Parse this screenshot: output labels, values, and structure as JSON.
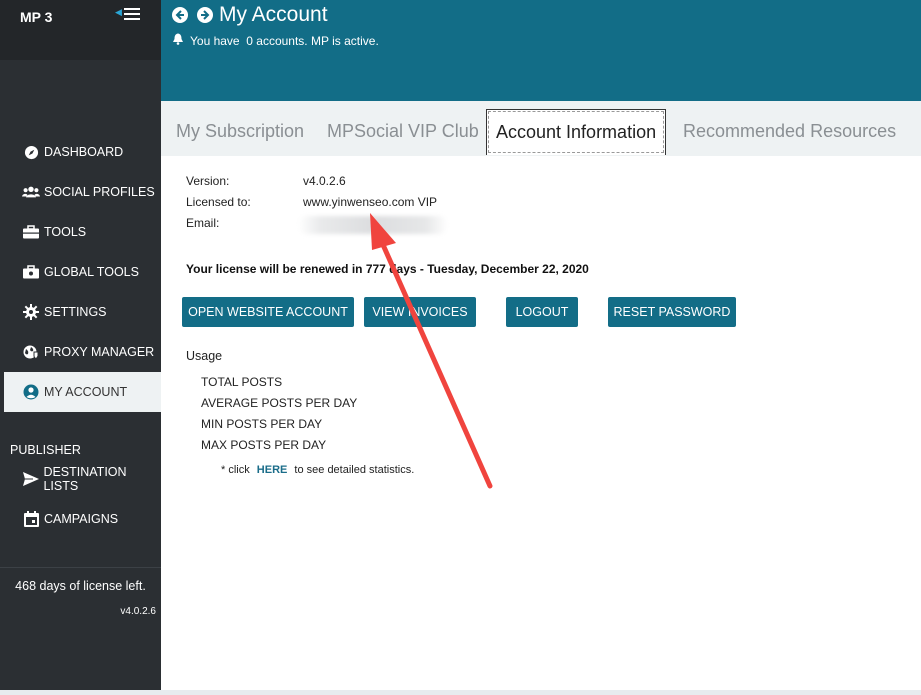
{
  "sidebar": {
    "brand": "MP 3",
    "items": [
      {
        "label": "DASHBOARD",
        "icon": "compass-icon"
      },
      {
        "label": "SOCIAL PROFILES",
        "icon": "users-icon"
      },
      {
        "label": "TOOLS",
        "icon": "briefcase-icon"
      },
      {
        "label": "GLOBAL TOOLS",
        "icon": "globe-icon"
      },
      {
        "label": "SETTINGS",
        "icon": "gear-icon"
      },
      {
        "label": "PROXY MANAGER",
        "icon": "globe-shield-icon"
      },
      {
        "label": "MY ACCOUNT",
        "icon": "user-circle-icon",
        "active": true
      }
    ],
    "publisher_label": "PUBLISHER",
    "publisher_items": [
      {
        "label": "DESTINATION LISTS",
        "icon": "paper-plane-icon"
      },
      {
        "label": "CAMPAIGNS",
        "icon": "calendar-icon"
      }
    ],
    "license_left": "468 days of license left.",
    "version": "v4.0.2.6"
  },
  "header": {
    "title": "My Account",
    "notice": "You have  0 accounts. MP is active."
  },
  "tabs": [
    {
      "label": "My Subscription"
    },
    {
      "label": "MPSocial VIP Club"
    },
    {
      "label": "Account Information",
      "active": true
    },
    {
      "label": "Recommended Resources"
    }
  ],
  "account": {
    "version_label": "Version:",
    "version_value": "v4.0.2.6",
    "licensed_label": "Licensed to:",
    "licensed_value": "www.yinwenseo.com VIP",
    "email_label": "Email:",
    "renewal": "Your license will be renewed in 777 days - Tuesday, December 22, 2020"
  },
  "buttons": {
    "open_website": "OPEN WEBSITE ACCOUNT",
    "view_invoices": "VIEW INVOICES",
    "logout": "LOGOUT",
    "reset_password": "RESET PASSWORD"
  },
  "usage": {
    "title": "Usage",
    "items": [
      "TOTAL POSTS",
      "AVERAGE POSTS PER DAY",
      "MIN POSTS PER DAY",
      "MAX POSTS PER DAY"
    ],
    "note_prefix": "* click",
    "note_link": "HERE",
    "note_suffix": "to see detailed statistics."
  },
  "colors": {
    "header": "#126d87",
    "sidebar": "#2b2f33",
    "button": "#136d87",
    "annotation_arrow": "#f0443e"
  }
}
